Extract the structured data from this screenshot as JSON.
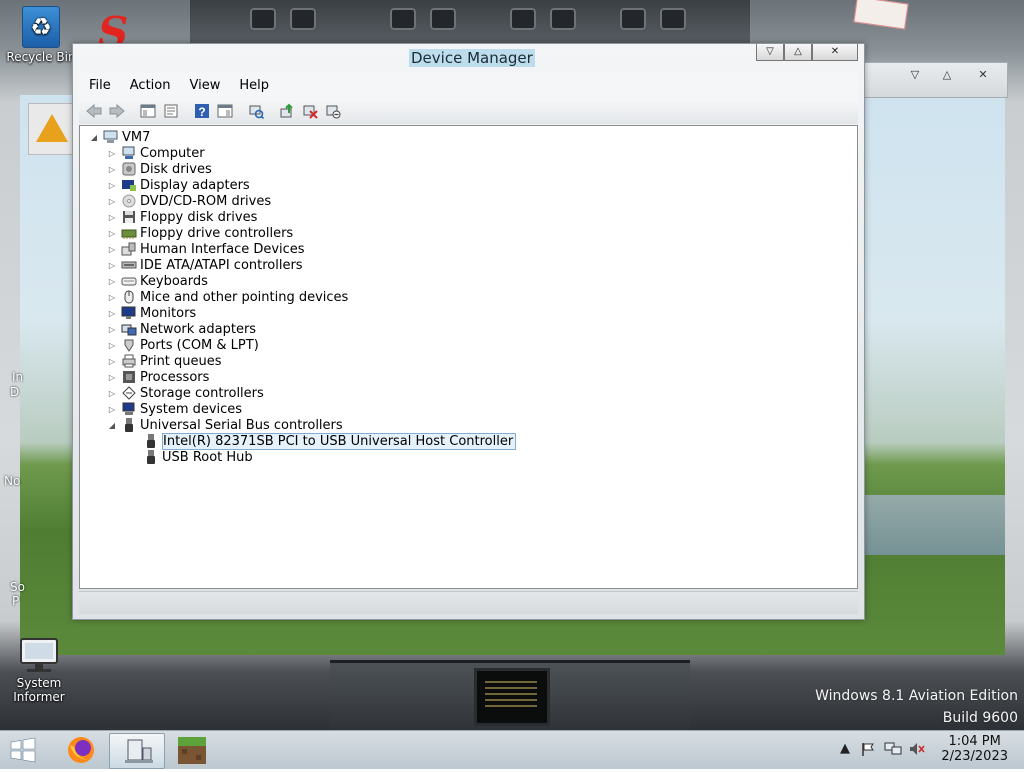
{
  "desktop": {
    "icons": {
      "recycle_bin": "Recycle Bin",
      "system_informer_line1": "System",
      "system_informer_line2": "Informer"
    },
    "partial_labels": {
      "behind_recycle": "le",
      "left_1": "In",
      "left_2": "D",
      "left_3": "No",
      "left_4": "So",
      "left_5": "P"
    },
    "watermark_line1": "Windows 8.1 Aviation Edition",
    "watermark_line2": "Build 9600"
  },
  "window": {
    "title": "Device Manager",
    "buttons": {
      "minimize": "▽",
      "maximize": "△",
      "close": "✕"
    },
    "menu": [
      "File",
      "Action",
      "View",
      "Help"
    ],
    "toolbar_icons": [
      "back-icon",
      "forward-icon",
      "separator",
      "show-hide-console-tree-icon",
      "properties-icon",
      "separator",
      "help-icon",
      "show-hide-action-pane-icon",
      "separator",
      "scan-hardware-icon",
      "separator",
      "update-driver-icon",
      "uninstall-device-icon",
      "disable-device-icon"
    ],
    "tree": {
      "root": "VM7",
      "categories": [
        {
          "label": "Computer",
          "icon": "computer-icon"
        },
        {
          "label": "Disk drives",
          "icon": "disk-drive-icon"
        },
        {
          "label": "Display adapters",
          "icon": "display-adapter-icon"
        },
        {
          "label": "DVD/CD-ROM drives",
          "icon": "cd-drive-icon"
        },
        {
          "label": "Floppy disk drives",
          "icon": "floppy-disk-icon"
        },
        {
          "label": "Floppy drive controllers",
          "icon": "floppy-controller-icon"
        },
        {
          "label": "Human Interface Devices",
          "icon": "hid-icon"
        },
        {
          "label": "IDE ATA/ATAPI controllers",
          "icon": "ide-controller-icon"
        },
        {
          "label": "Keyboards",
          "icon": "keyboard-icon"
        },
        {
          "label": "Mice and other pointing devices",
          "icon": "mouse-icon"
        },
        {
          "label": "Monitors",
          "icon": "monitor-icon"
        },
        {
          "label": "Network adapters",
          "icon": "network-adapter-icon"
        },
        {
          "label": "Ports (COM & LPT)",
          "icon": "port-icon"
        },
        {
          "label": "Print queues",
          "icon": "printer-icon"
        },
        {
          "label": "Processors",
          "icon": "processor-icon"
        },
        {
          "label": "Storage controllers",
          "icon": "storage-controller-icon"
        },
        {
          "label": "System devices",
          "icon": "system-device-icon"
        },
        {
          "label": "Universal Serial Bus controllers",
          "icon": "usb-icon"
        }
      ],
      "usb_children": [
        "Intel(R) 82371SB PCI to USB Universal Host Controller",
        "USB Root Hub"
      ]
    }
  },
  "taskbar": {
    "apps": [
      "start-button",
      "firefox-app",
      "device-manager-app",
      "minecraft-app"
    ],
    "tray_icons": [
      "show-hidden-icons",
      "action-center-flag-icon",
      "network-icon",
      "volume-muted-icon"
    ],
    "clock_time": "1:04 PM",
    "clock_date": "2/23/2023"
  }
}
